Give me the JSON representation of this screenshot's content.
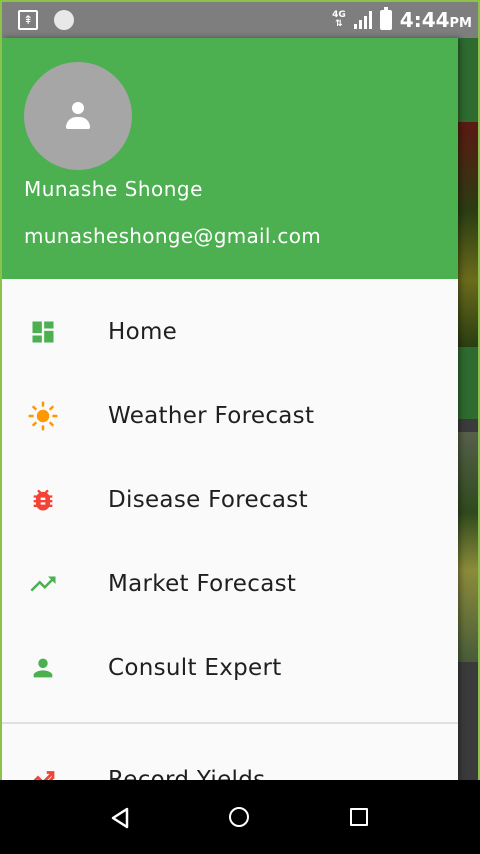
{
  "status_bar": {
    "network": "4G",
    "time": "4:44",
    "ampm": "PM"
  },
  "drawer": {
    "user": {
      "name": "Munashe Shonge",
      "email": "munasheshonge@gmail.com"
    },
    "menu": [
      {
        "label": "Home",
        "icon": "dashboard-icon",
        "color": "#4caf50"
      },
      {
        "label": "Weather Forecast",
        "icon": "sun-icon",
        "color": "#ff9800"
      },
      {
        "label": "Disease Forecast",
        "icon": "bug-icon",
        "color": "#f44336"
      },
      {
        "label": "Market Forecast",
        "icon": "trending-up-icon",
        "color": "#4caf50"
      },
      {
        "label": "Consult Expert",
        "icon": "person-icon",
        "color": "#4caf50"
      }
    ],
    "secondary_menu": [
      {
        "label": "Record Yields",
        "icon": "record-yields-icon",
        "color": "#f44336"
      }
    ]
  },
  "colors": {
    "header_green": "#4caf50",
    "drawer_bg": "#fafafa"
  }
}
